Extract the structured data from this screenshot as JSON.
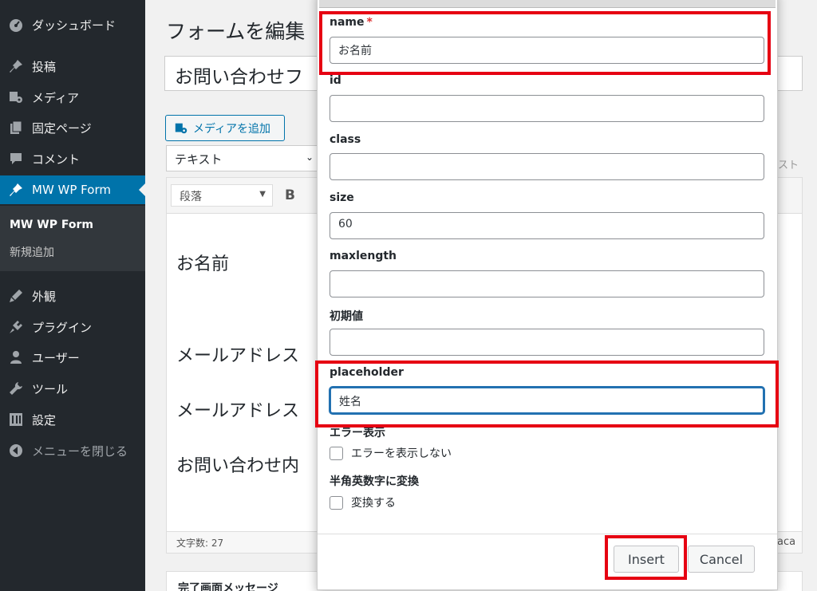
{
  "sidebar": {
    "items": [
      {
        "label": "ダッシュボード",
        "icon": "dashboard-icon"
      },
      {
        "label": "投稿",
        "icon": "pin-icon"
      },
      {
        "label": "メディア",
        "icon": "media-icon"
      },
      {
        "label": "固定ページ",
        "icon": "pages-icon"
      },
      {
        "label": "コメント",
        "icon": "comment-icon"
      },
      {
        "label": "MW WP Form",
        "icon": "pin-icon"
      },
      {
        "label": "外観",
        "icon": "appearance-icon"
      },
      {
        "label": "プラグイン",
        "icon": "plugin-icon"
      },
      {
        "label": "ユーザー",
        "icon": "user-icon"
      },
      {
        "label": "ツール",
        "icon": "wrench-icon"
      },
      {
        "label": "設定",
        "icon": "settings-icon"
      },
      {
        "label": "メニューを閉じる",
        "icon": "collapse-icon"
      }
    ],
    "submenu": [
      {
        "label": "MW WP Form"
      },
      {
        "label": "新規追加"
      }
    ]
  },
  "main": {
    "page_title": "フォームを編集",
    "title_value": "お問い合わせフ",
    "media_button": "メディアを追加",
    "text_tab": "テキスト",
    "right_tab_fragment": "スト",
    "paragraph_select": "段落",
    "bold_label": "B",
    "editor_lines": [
      "お名前",
      "メールアドレス",
      "メールアドレス",
      "お問い合わせ内"
    ],
    "word_count": "文字数: 27",
    "status_right_fragment": "aca",
    "bottom_box_title": "完了画面メッセージ"
  },
  "modal": {
    "fields": [
      {
        "label": "name",
        "required_mark": "*",
        "value": "お名前"
      },
      {
        "label": "id",
        "value": ""
      },
      {
        "label": "class",
        "value": ""
      },
      {
        "label": "size",
        "value": "60"
      },
      {
        "label": "maxlength",
        "value": ""
      },
      {
        "label": "初期値",
        "value": ""
      },
      {
        "label": "placeholder",
        "value": "姓名"
      }
    ],
    "error_section_label": "エラー表示",
    "error_checkbox_label": "エラーを表示しない",
    "convert_section_label": "半角英数字に変換",
    "convert_checkbox_label": "変換する",
    "insert_button": "Insert",
    "cancel_button": "Cancel"
  },
  "colors": {
    "sidebar_bg": "#23282d",
    "active_menu": "#0073aa",
    "annotation_red": "#e60012",
    "focus_blue": "#2271b1"
  }
}
